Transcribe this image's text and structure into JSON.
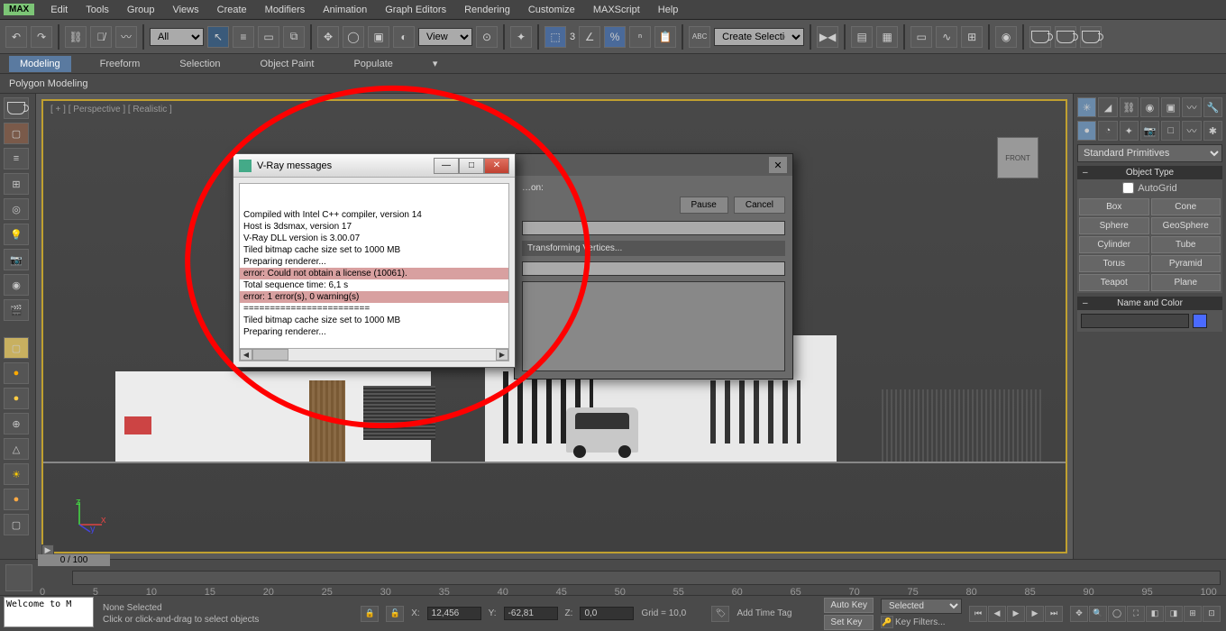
{
  "app": {
    "logo": "MAX"
  },
  "menu": [
    "Edit",
    "Tools",
    "Group",
    "Views",
    "Create",
    "Modifiers",
    "Animation",
    "Graph Editors",
    "Rendering",
    "Customize",
    "MAXScript",
    "Help"
  ],
  "toolbar_dropdowns": {
    "all": "All",
    "view": "View",
    "create_sel": "Create Selection Se"
  },
  "toolbar_spinner": "3",
  "ribbon_tabs": [
    "Modeling",
    "Freeform",
    "Selection",
    "Object Paint",
    "Populate"
  ],
  "ribbon_sub": "Polygon Modeling",
  "viewport": {
    "label": "[ + ] [ Perspective ] [ Realistic ]",
    "cube": "FRONT"
  },
  "right_panel": {
    "primitive_dropdown": "Standard Primitives",
    "sections": {
      "object_type": "Object Type",
      "name_color": "Name and Color"
    },
    "autogrid": "AutoGrid",
    "buttons": [
      "Box",
      "Cone",
      "Sphere",
      "GeoSphere",
      "Cylinder",
      "Tube",
      "Torus",
      "Pyramid",
      "Teapot",
      "Plane"
    ]
  },
  "timeline": {
    "frame": "0 / 100",
    "ticks": [
      "0",
      "5",
      "10",
      "15",
      "20",
      "25",
      "30",
      "35",
      "40",
      "45",
      "50",
      "55",
      "60",
      "65",
      "70",
      "75",
      "80",
      "85",
      "90",
      "95",
      "100"
    ]
  },
  "status": {
    "selection": "None Selected",
    "hint": "Click or click-and-drag to select objects",
    "x_label": "X:",
    "x_val": "12,456",
    "y_label": "Y:",
    "y_val": "-62,81",
    "z_label": "Z:",
    "z_val": "0,0",
    "grid": "Grid = 10,0",
    "add_time_tag": "Add Time Tag",
    "auto_key": "Auto Key",
    "set_key": "Set Key",
    "selected": "Selected",
    "key_filters": "Key Filters..."
  },
  "welcome": "Welcome to M",
  "render_dialog": {
    "pause": "Pause",
    "cancel": "Cancel",
    "status": "Transforming Vertices..."
  },
  "vray_dialog": {
    "title": "V-Ray messages",
    "lines": [
      {
        "t": "",
        "err": false
      },
      {
        "t": "Compiled with Intel C++ compiler, version 14",
        "err": false
      },
      {
        "t": "Host is 3dsmax, version 17",
        "err": false
      },
      {
        "t": "V-Ray DLL version is 3.00.07",
        "err": false
      },
      {
        "t": "Tiled bitmap cache size set to 1000 MB",
        "err": false
      },
      {
        "t": "Preparing renderer...",
        "err": false
      },
      {
        "t": "error: Could not obtain a license (10061).",
        "err": true
      },
      {
        "t": "Total sequence time: 6,1 s",
        "err": false
      },
      {
        "t": "error: 1 error(s), 0 warning(s)",
        "err": true
      },
      {
        "t": "========================",
        "err": false
      },
      {
        "t": "Tiled bitmap cache size set to 1000 MB",
        "err": false
      },
      {
        "t": "Preparing renderer...",
        "err": false
      }
    ]
  }
}
